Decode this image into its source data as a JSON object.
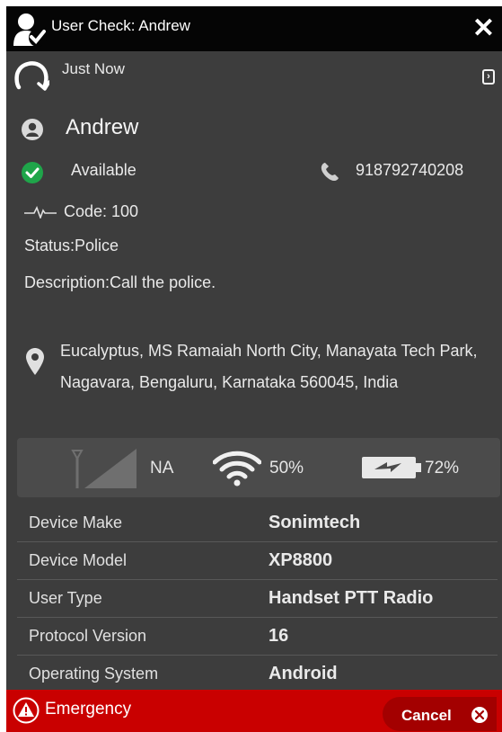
{
  "header": {
    "title": "User Check: Andrew",
    "close_glyph": "✕",
    "background": "#050505"
  },
  "update": {
    "time_text": "Just Now",
    "expand_glyph": "›"
  },
  "user": {
    "name": "Andrew",
    "availability": "Available",
    "availability_color": "#1fa54a",
    "phone": "918792740208",
    "code": "Code: 100",
    "status": "Status:Police",
    "description": "Description:Call the police."
  },
  "location": {
    "address": "Eucalyptus, MS Ramaiah North City, Manayata Tech Park, Nagavara, Bengaluru, Karnataka 560045, India"
  },
  "signals": {
    "cellular": "NA",
    "wifi": "50%",
    "battery": "72%"
  },
  "device_details": [
    {
      "label": "Device Make",
      "value": "Sonimtech"
    },
    {
      "label": "Device Model",
      "value": "XP8800"
    },
    {
      "label": "User Type",
      "value": "Handset PTT Radio"
    },
    {
      "label": "Protocol Version",
      "value": "16"
    },
    {
      "label": "Operating System",
      "value": "Android"
    }
  ],
  "emergency": {
    "label": "Emergency",
    "cancel_label": "Cancel",
    "color": "#c90000"
  },
  "icons": [
    "user-check-icon",
    "close-icon",
    "refresh-icon",
    "expand-icon",
    "avatar-icon",
    "available-check-icon",
    "phone-icon",
    "pulse-icon",
    "location-pin-icon",
    "antenna-icon",
    "wifi-icon",
    "battery-charging-icon",
    "warning-icon",
    "cancel-x-icon"
  ]
}
